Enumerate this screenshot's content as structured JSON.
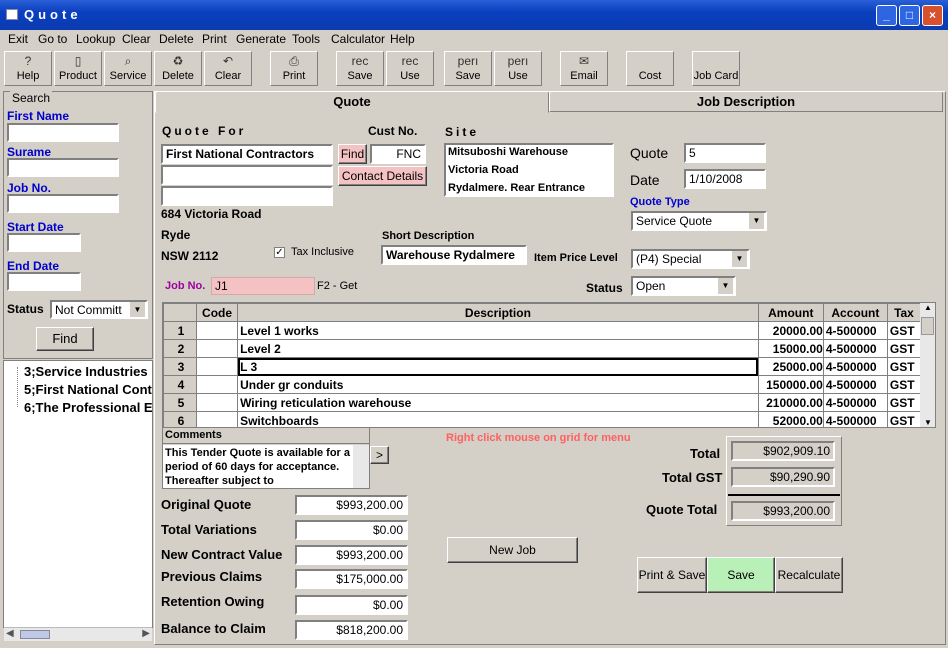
{
  "window": {
    "title": "Quote"
  },
  "menu": [
    "Exit",
    "Go to",
    "Lookup",
    "Clear",
    "Delete",
    "Print",
    "Generate",
    "Tools",
    "Calculator",
    "Help"
  ],
  "toolbar": {
    "help": "Help",
    "product": "Product",
    "service": "Service",
    "delete": "Delete",
    "clear": "Clear",
    "print": "Print",
    "rec_save_top": "rec",
    "rec_save": "Save",
    "rec_use_top": "rec",
    "rec_use": "Use",
    "perm_save_top": "perı",
    "perm_save": "Save",
    "perm_use_top": "perı",
    "perm_use": "Use",
    "email": "Email",
    "cost": "Cost",
    "job_card": "Job Card"
  },
  "search": {
    "title": "Search",
    "first_name": "First Name",
    "surname": "Surame",
    "job_no": "Job No.",
    "start_date": "Start Date",
    "end_date": "End Date",
    "status_label": "Status",
    "status_value": "Not Committ",
    "find": "Find",
    "results": [
      "3;Service Industries",
      "5;First National Cont",
      "6;The Professional E"
    ]
  },
  "tabs": {
    "quote": "Quote",
    "job_description": "Job Description"
  },
  "quote_for": {
    "label": "Quote For",
    "name": "First National Contractors",
    "line2": "",
    "line3": "",
    "address1": "684 Victoria Road",
    "address2": "Ryde",
    "address3": "NSW  2112",
    "find": "Find",
    "cust_no_label": "Cust No.",
    "cust_no": "FNC",
    "contact_details": "Contact Details"
  },
  "site": {
    "label": "Site",
    "line1": "Mitsuboshi Warehouse",
    "line2": "Victoria Road",
    "line3": "Rydalmere. Rear Entrance"
  },
  "quote": {
    "quote_label": "Quote",
    "quote_no": "5",
    "date_label": "Date",
    "date": "1/10/2008",
    "type_label": "Quote Type",
    "type": "Service Quote",
    "tax_inclusive": "Tax Inclusive",
    "short_desc_label": "Short Description",
    "short_desc": "Warehouse Rydalmere",
    "price_level_label": "Item Price Level",
    "price_level": "(P4) Special",
    "status_label": "Status",
    "status": "Open",
    "job_no_label": "Job No.",
    "job_no": "J1",
    "job_hint": "F2 - Get"
  },
  "grid": {
    "headers": [
      "Code",
      "Description",
      "Amount",
      "Account",
      "Tax"
    ],
    "rows": [
      {
        "n": "1",
        "code": "",
        "desc": "Level 1 works",
        "amount": "20000.00",
        "account": "4-500000",
        "tax": "GST"
      },
      {
        "n": "2",
        "code": "",
        "desc": "Level 2",
        "amount": "15000.00",
        "account": "4-500000",
        "tax": "GST"
      },
      {
        "n": "3",
        "code": "",
        "desc": "L 3",
        "amount": "25000.00",
        "account": "4-500000",
        "tax": "GST"
      },
      {
        "n": "4",
        "code": "",
        "desc": "Under gr conduits",
        "amount": "150000.00",
        "account": "4-500000",
        "tax": "GST"
      },
      {
        "n": "5",
        "code": "",
        "desc": "Wiring reticulation warehouse",
        "amount": "210000.00",
        "account": "4-500000",
        "tax": "GST"
      },
      {
        "n": "6",
        "code": "",
        "desc": "Switchboards",
        "amount": "52000.00",
        "account": "4-500000",
        "tax": "GST"
      }
    ],
    "hint": "Right click mouse on grid for menu"
  },
  "comments": {
    "label": "Comments",
    "text": "This Tender Quote is available for a period of 60 days for acceptance. Thereafter subject to",
    "arrow": ">"
  },
  "totals": {
    "total_label": "Total",
    "total": "$902,909.10",
    "gst_label": "Total GST",
    "gst": "$90,290.90",
    "quote_total_label": "Quote Total",
    "quote_total": "$993,200.00"
  },
  "summary": {
    "original_label": "Original Quote",
    "original": "$993,200.00",
    "variations_label": "Total Variations",
    "variations": "$0.00",
    "ncv_label": "New Contract Value",
    "ncv": "$993,200.00",
    "prev_label": "Previous Claims",
    "prev": "$175,000.00",
    "ret_label": "Retention Owing",
    "ret": "$0.00",
    "bal_label": "Balance to Claim",
    "bal": "$818,200.00"
  },
  "buttons": {
    "new_job": "New Job",
    "print_save": "Print & Save",
    "save": "Save",
    "recalculate": "Recalculate"
  },
  "colors": {
    "title": "#0a3fbf",
    "pink": "#f4c2c2",
    "green": "#b8f0b8",
    "blue_label": "#0000cc"
  }
}
